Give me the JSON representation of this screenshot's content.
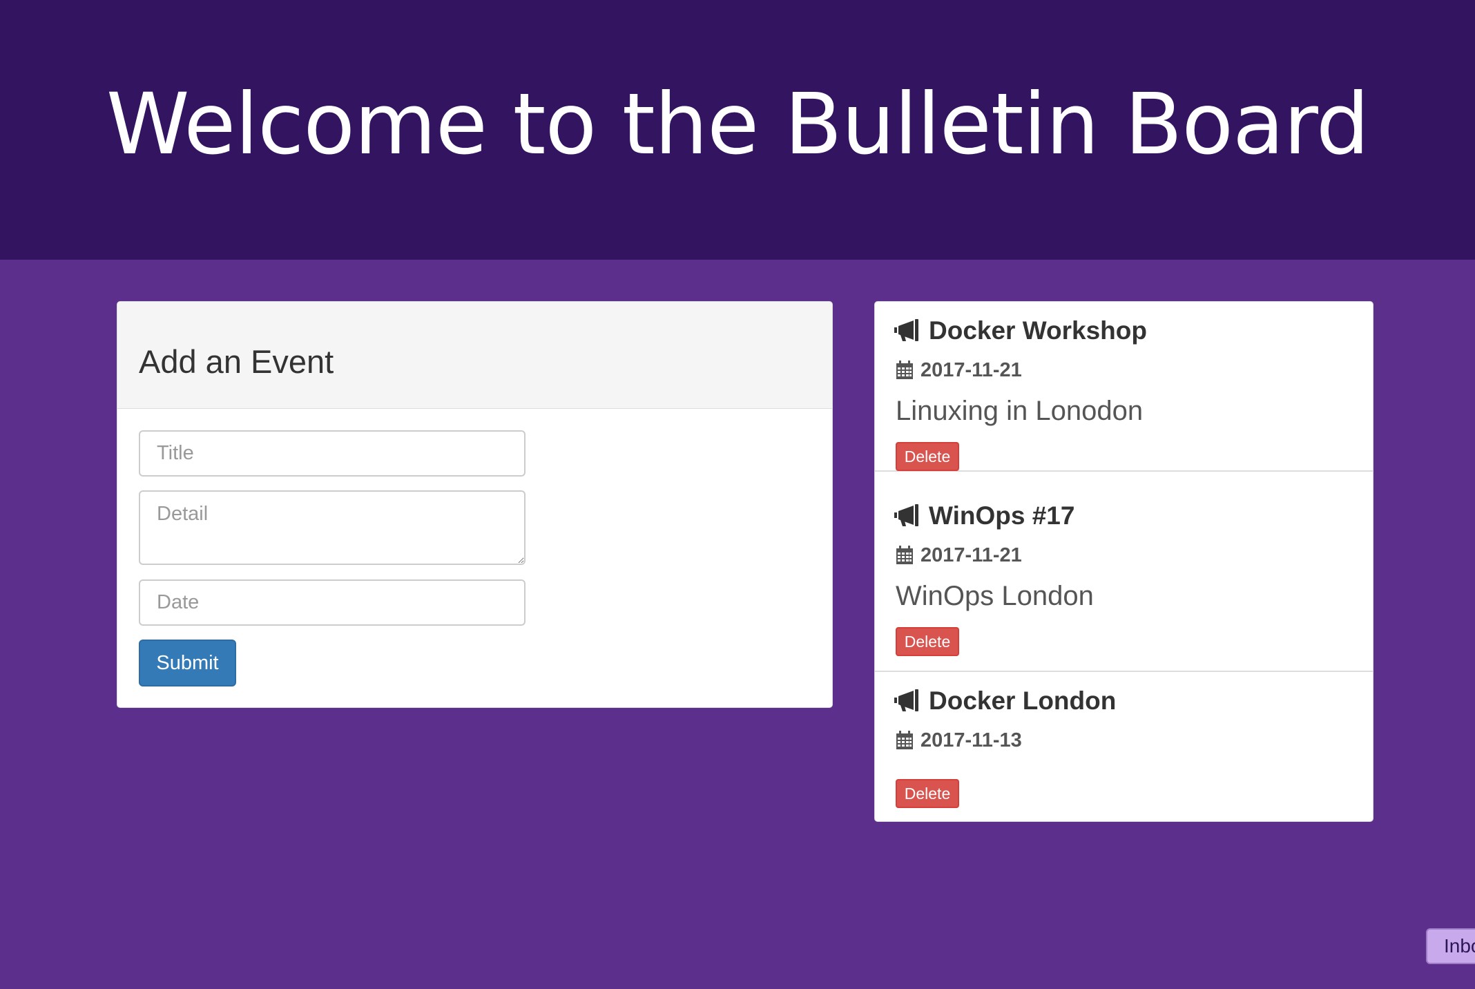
{
  "header": {
    "title": "Welcome to the Bulletin Board"
  },
  "form": {
    "heading": "Add an Event",
    "title_placeholder": "Title",
    "detail_placeholder": "Detail",
    "date_placeholder": "Date",
    "submit_label": "Submit"
  },
  "events": [
    {
      "title": "Docker Workshop",
      "date": "2017-11-21",
      "detail": "Linuxing in Lonodon",
      "delete_label": "Delete"
    },
    {
      "title": "WinOps #17",
      "date": "2017-11-21",
      "detail": "WinOps London",
      "delete_label": "Delete"
    },
    {
      "title": "Docker London",
      "date": "2017-11-13",
      "detail": "",
      "delete_label": "Delete"
    }
  ],
  "inbox_tab": {
    "label": "Inbo"
  },
  "icons": {
    "event": "bullhorn-icon",
    "date": "calendar-icon"
  },
  "colors": {
    "hero": "#331460",
    "background": "#5b2f8b",
    "submit": "#337ab7",
    "delete": "#d9534f"
  }
}
